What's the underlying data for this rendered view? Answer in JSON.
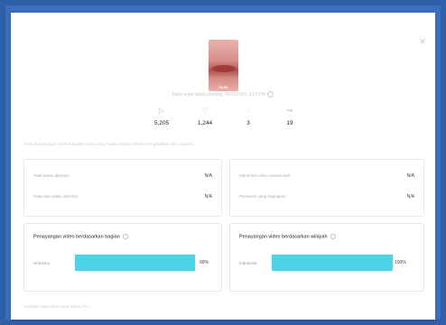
{
  "modal": {
    "close_glyph": "×",
    "thumbnail": {
      "duration": "28.9k"
    },
    "posted_text": "Data sejak waktu posting: 09/15/2021 3:23 PM",
    "stats": [
      {
        "icon": "play-icon",
        "glyph": "▷",
        "value": "5,205"
      },
      {
        "icon": "heart-icon",
        "glyph": "♡",
        "value": "1,244"
      },
      {
        "icon": "comment-icon",
        "glyph": "◌",
        "value": "3"
      },
      {
        "icon": "share-icon",
        "glyph": "↪",
        "value": "19"
      }
    ],
    "note": "Anda hanya dapat melihat analitik video yang Anda posting setelah mengaktifkan akun analitik.",
    "metrics_left": [
      {
        "label": "Total waktu ditonton",
        "value": "N/A"
      },
      {
        "label": "Rata-rata waktu ditonton",
        "value": "N/A"
      }
    ],
    "metrics_right": [
      {
        "label": "Menonton video secara utuh",
        "value": "N/A"
      },
      {
        "label": "Penonton yang Dijangkau",
        "value": "N/A"
      }
    ],
    "section_left": {
      "title": "Penayangan video berdasarkan bagian",
      "bar_label": "Untukmu",
      "percent": "99%",
      "fraction": 0.99
    },
    "section_right": {
      "title": "Penayangan video berdasarkan wilayah",
      "bar_label": "Indonesia",
      "percent": "100%",
      "fraction": 1.0
    },
    "footer": "Tampilan data pada zona waktu UTC"
  },
  "colors": {
    "bar": "#4dd3e8",
    "frame": "#3b6fbd"
  }
}
